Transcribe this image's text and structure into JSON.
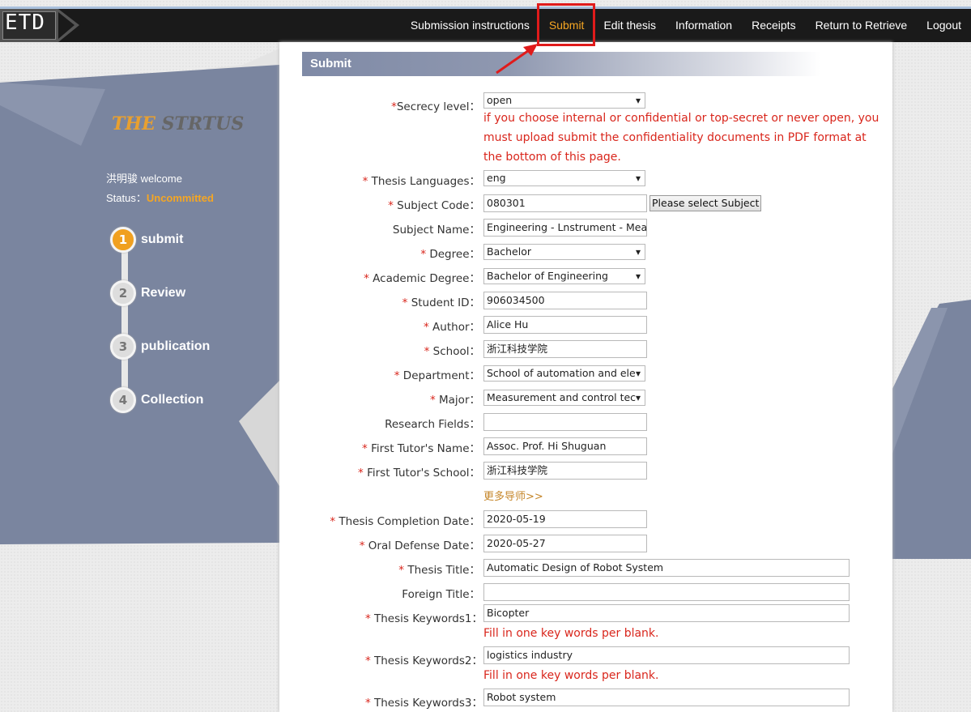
{
  "header": {
    "logo_text": "ETD",
    "nav": [
      {
        "label": "Submission instructions",
        "active": false
      },
      {
        "label": "Submit",
        "active": true
      },
      {
        "label": "Edit thesis",
        "active": false
      },
      {
        "label": "Information",
        "active": false
      },
      {
        "label": "Receipts",
        "active": false
      },
      {
        "label": "Return to Retrieve",
        "active": false
      },
      {
        "label": "Logout",
        "active": false
      }
    ]
  },
  "sidebar": {
    "title_highlight": "THE",
    "title_rest": "STRTUS",
    "user_name": "洪明骏",
    "welcome": "welcome",
    "status_label": "Status：",
    "status_value": "Uncommitted",
    "steps": [
      {
        "num": "1",
        "label": "submit",
        "active": true
      },
      {
        "num": "2",
        "label": "Review",
        "active": false
      },
      {
        "num": "3",
        "label": "publication",
        "active": false
      },
      {
        "num": "4",
        "label": "Collection",
        "active": false
      }
    ]
  },
  "form": {
    "title": "Submit",
    "secrecy": {
      "label": "Secrecy level：",
      "value": "open",
      "hint": [
        "if you choose internal or confidential or top-secret or never open, you",
        "must upload submit the confidentiality documents in PDF format at",
        "the bottom of this page."
      ]
    },
    "languages": {
      "label": "Thesis Languages：",
      "value": "eng"
    },
    "subject_code": {
      "label": "Subject Code：",
      "value": "080301",
      "button": "Please select Subject"
    },
    "subject_name": {
      "label": "Subject Name：",
      "value": "Engineering - Lnstrument - Measu"
    },
    "degree": {
      "label": "Degree：",
      "value": "Bachelor"
    },
    "academic_degree": {
      "label": "Academic Degree：",
      "value": "Bachelor of Engineering"
    },
    "student_id": {
      "label": "Student ID：",
      "value": "906034500"
    },
    "author": {
      "label": "Author：",
      "value": "Alice Hu"
    },
    "school": {
      "label": "School：",
      "value": "浙江科技学院"
    },
    "department": {
      "label": "Department：",
      "value": "School of automation and ele"
    },
    "major": {
      "label": "Major：",
      "value": "Measurement and control tec"
    },
    "research_fields": {
      "label": "Research Fields：",
      "value": ""
    },
    "tutor_name": {
      "label": "First Tutor's Name：",
      "value": "Assoc. Prof. Hi Shuguan"
    },
    "tutor_school": {
      "label": "First Tutor's School：",
      "value": "浙江科技学院"
    },
    "more_tutors": "更多导师>>",
    "completion_date": {
      "label": "Thesis Completion Date：",
      "value": "2020-05-19"
    },
    "defense_date": {
      "label": "Oral Defense Date：",
      "value": "2020-05-27"
    },
    "thesis_title": {
      "label": "Thesis Title：",
      "value": "Automatic Design of  Robot  System"
    },
    "foreign_title": {
      "label": "Foreign Title：",
      "value": ""
    },
    "keywords1": {
      "label": "Thesis Keywords1：",
      "value": "Bicopter",
      "hint": "Fill in one key words per blank."
    },
    "keywords2": {
      "label": "Thesis Keywords2：",
      "value": "logistics industry",
      "hint": "Fill in one key words per blank."
    },
    "keywords3": {
      "label": "Thesis Keywords3：",
      "value": "Robot  system"
    }
  },
  "colors": {
    "accent": "#f5a623",
    "required": "#d9261c",
    "annotation": "#e01b1b",
    "sidebar_bg": "#7a859f"
  }
}
